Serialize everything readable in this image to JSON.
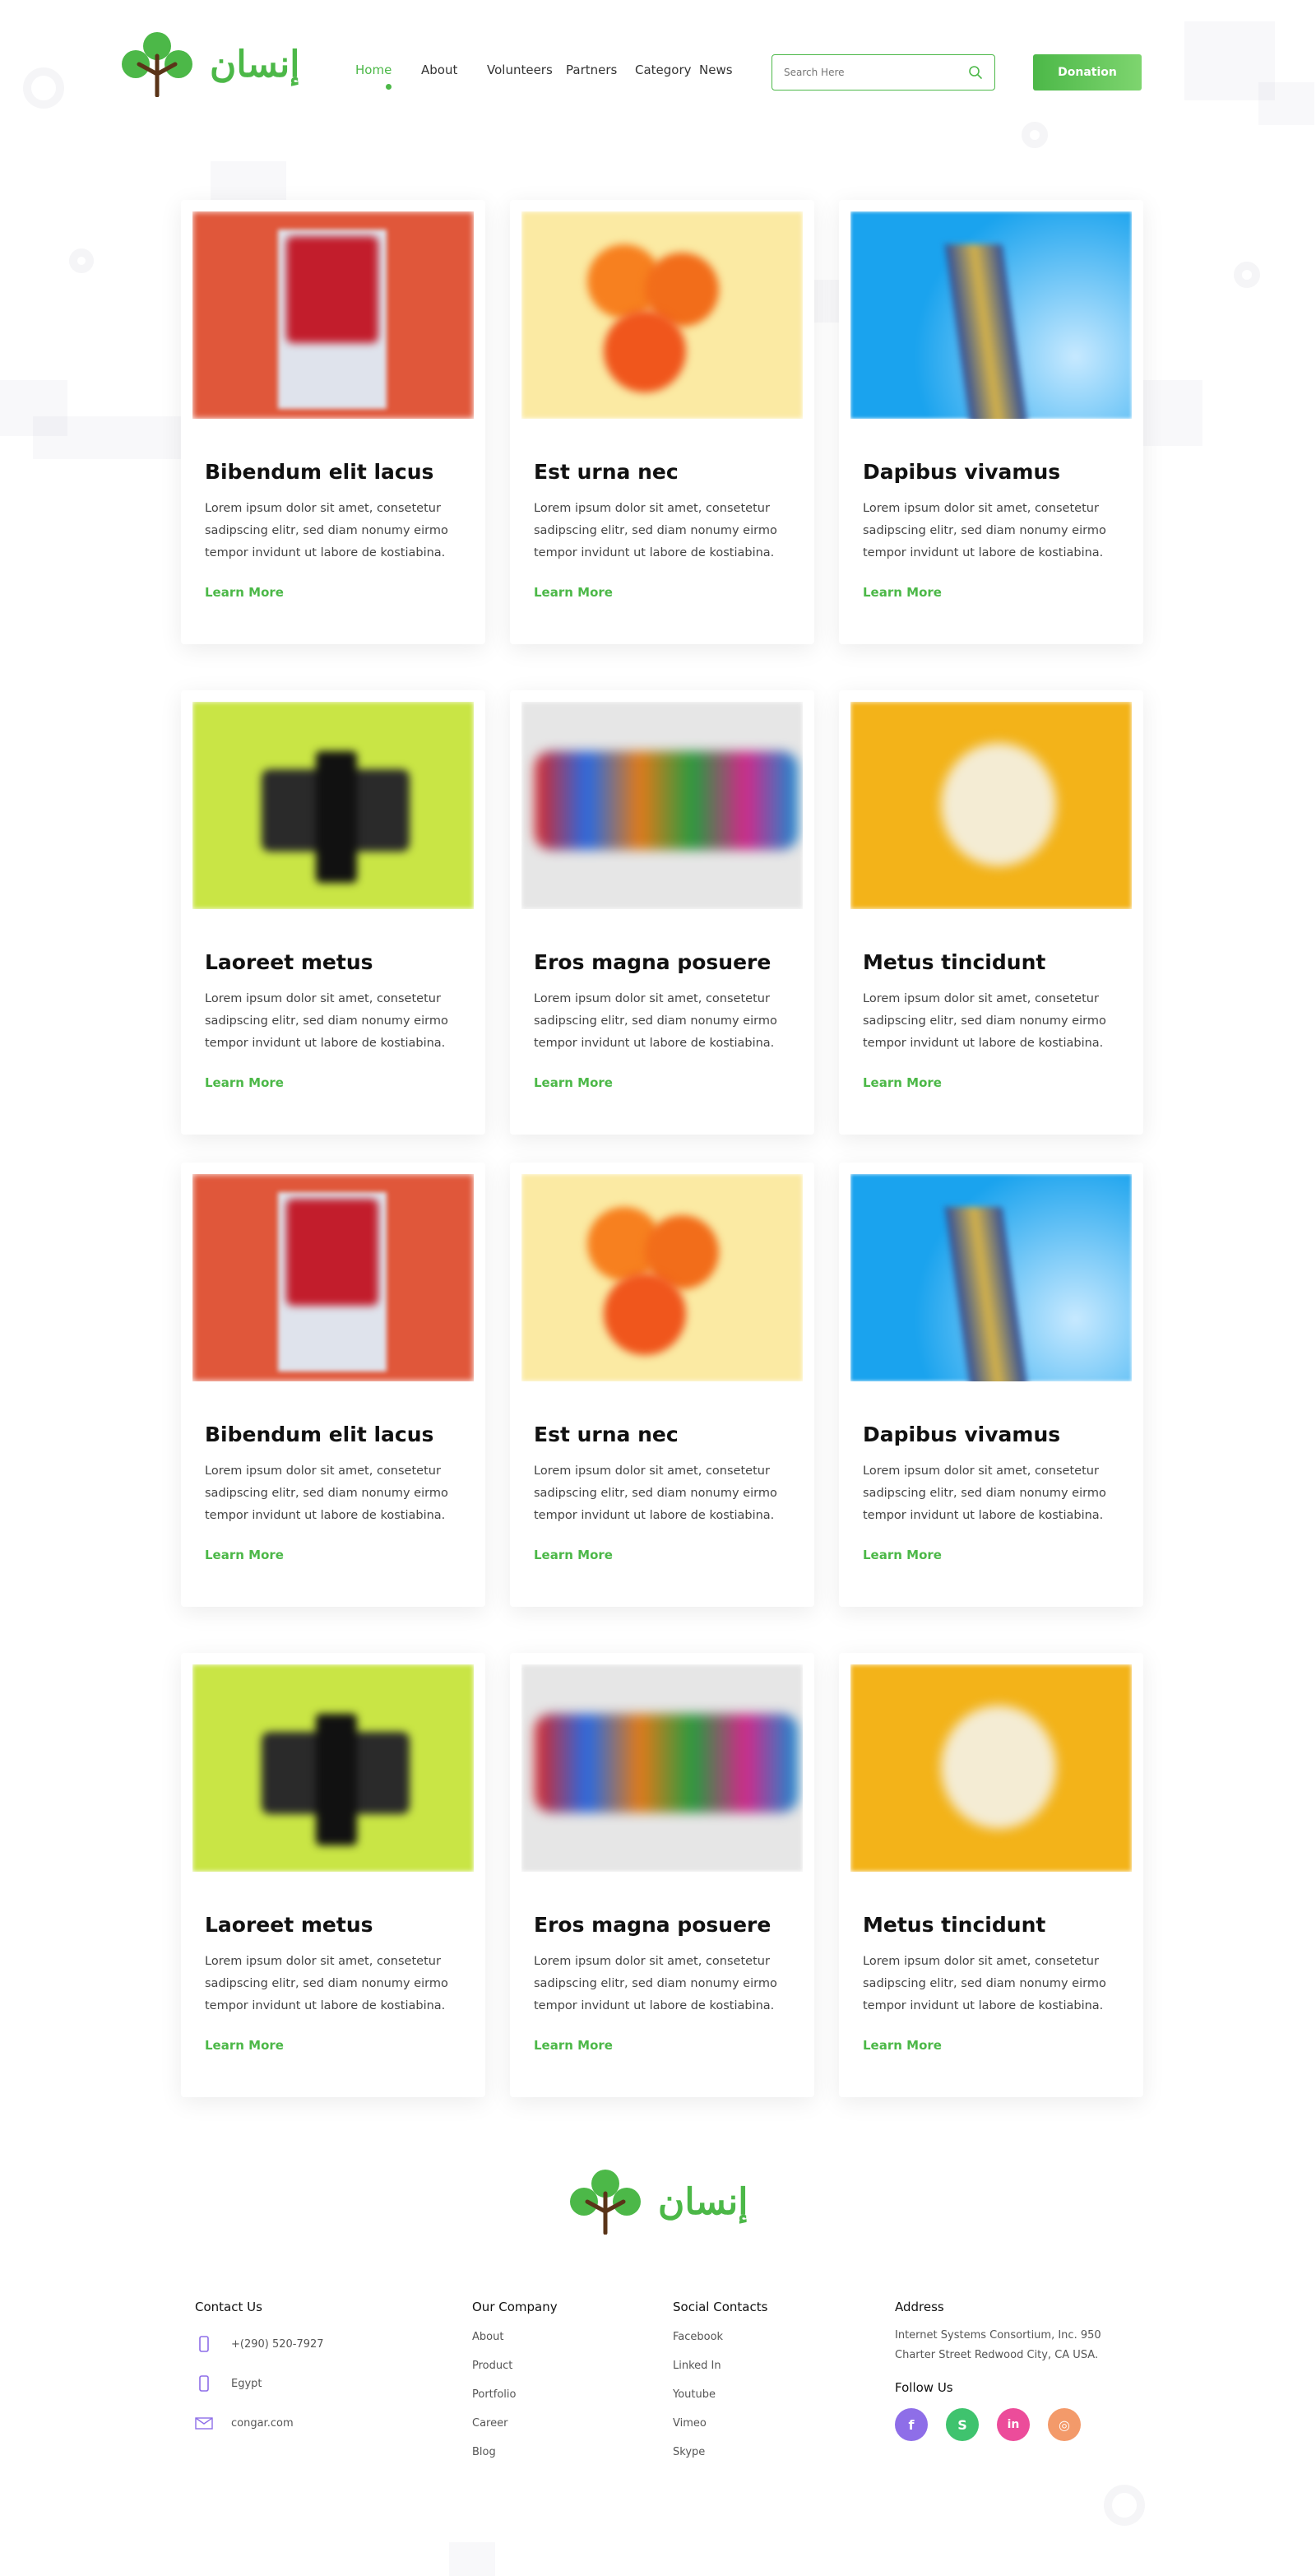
{
  "brand": {
    "logo_text": "إنسان",
    "accent": "#4cb848"
  },
  "nav": {
    "items": [
      {
        "label": "Home",
        "active": true
      },
      {
        "label": "About",
        "active": false
      },
      {
        "label": "Volunteers",
        "active": false
      },
      {
        "label": "Partners",
        "active": false
      },
      {
        "label": "Category",
        "active": false
      },
      {
        "label": "News",
        "active": false
      }
    ]
  },
  "search": {
    "placeholder": "Search Here",
    "icon": "search-icon"
  },
  "donate": {
    "label": "Donation"
  },
  "cards": [
    {
      "title": "Bibendum elit lacus",
      "text": "Lorem ipsum dolor sit amet, consetetur sadipscing elitr, sed diam nonumy eirmo tempor invidunt ut labore de kostiabina.",
      "link": "Learn More",
      "image": "red-peppers"
    },
    {
      "title": "Est urna nec",
      "text": "Lorem ipsum dolor sit amet, consetetur sadipscing elitr, sed diam nonumy eirmo tempor invidunt ut labore de kostiabina.",
      "link": "Learn More",
      "image": "orange-slices"
    },
    {
      "title": "Dapibus vivamus",
      "text": "Lorem ipsum dolor sit amet, consetetur sadipscing elitr, sed diam nonumy eirmo tempor invidunt ut labore de kostiabina.",
      "link": "Learn More",
      "image": "building-sky"
    },
    {
      "title": "Laoreet metus",
      "text": "Lorem ipsum dolor sit amet, consetetur sadipscing elitr, sed diam nonumy eirmo tempor invidunt ut labore de kostiabina.",
      "link": "Learn More",
      "image": "camera"
    },
    {
      "title": "Eros magna posuere",
      "text": "Lorem ipsum dolor sit amet, consetetur sadipscing elitr, sed diam nonumy eirmo tempor invidunt ut labore de kostiabina.",
      "link": "Learn More",
      "image": "paint-palette"
    },
    {
      "title": "Metus tincidunt",
      "text": "Lorem ipsum dolor sit amet, consetetur sadipscing elitr, sed diam nonumy eirmo tempor invidunt ut labore de kostiabina.",
      "link": "Learn More",
      "image": "peeled-orange"
    },
    {
      "title": "Bibendum elit lacus",
      "text": "Lorem ipsum dolor sit amet, consetetur sadipscing elitr, sed diam nonumy eirmo tempor invidunt ut labore de kostiabina.",
      "link": "Learn More",
      "image": "red-peppers"
    },
    {
      "title": "Est urna nec",
      "text": "Lorem ipsum dolor sit amet, consetetur sadipscing elitr, sed diam nonumy eirmo tempor invidunt ut labore de kostiabina.",
      "link": "Learn More",
      "image": "orange-slices"
    },
    {
      "title": "Dapibus vivamus",
      "text": "Lorem ipsum dolor sit amet, consetetur sadipscing elitr, sed diam nonumy eirmo tempor invidunt ut labore de kostiabina.",
      "link": "Learn More",
      "image": "building-sky"
    },
    {
      "title": "Laoreet metus",
      "text": "Lorem ipsum dolor sit amet, consetetur sadipscing elitr, sed diam nonumy eirmo tempor invidunt ut labore de kostiabina.",
      "link": "Learn More",
      "image": "camera"
    },
    {
      "title": "Eros magna posuere",
      "text": "Lorem ipsum dolor sit amet, consetetur sadipscing elitr, sed diam nonumy eirmo tempor invidunt ut labore de kostiabina.",
      "link": "Learn More",
      "image": "paint-palette"
    },
    {
      "title": "Metus tincidunt",
      "text": "Lorem ipsum dolor sit amet, consetetur sadipscing elitr, sed diam nonumy eirmo tempor invidunt ut labore de kostiabina.",
      "link": "Learn More",
      "image": "peeled-orange"
    }
  ],
  "footer": {
    "contact": {
      "title": "Contact Us",
      "items": [
        {
          "icon": "phone-icon",
          "text": "+(290) 520-7927"
        },
        {
          "icon": "mobile-icon",
          "text": "Egypt"
        },
        {
          "icon": "mail-icon",
          "text": "congar.com"
        }
      ]
    },
    "company": {
      "title": "Our Company",
      "links": [
        "About",
        "Product",
        "Portfolio",
        "Career",
        "Blog"
      ]
    },
    "social": {
      "title": "Social Contacts",
      "links": [
        "Facebook",
        "Linked In",
        "Youtube",
        "Vimeo",
        "Skype"
      ]
    },
    "address": {
      "title": "Address",
      "text": "Internet Systems Consortium, Inc. 950 Charter Street Redwood City, CA USA.",
      "follow_title": "Follow Us",
      "icons": [
        {
          "name": "facebook-icon",
          "glyph": "f",
          "color": "#8e6ee8"
        },
        {
          "name": "skype-icon",
          "glyph": "S",
          "color": "#3fc36e"
        },
        {
          "name": "linkedin-icon",
          "glyph": "in",
          "color": "#ec4c9a"
        },
        {
          "name": "instagram-icon",
          "glyph": "◎",
          "color": "#f39a6a"
        }
      ]
    }
  }
}
